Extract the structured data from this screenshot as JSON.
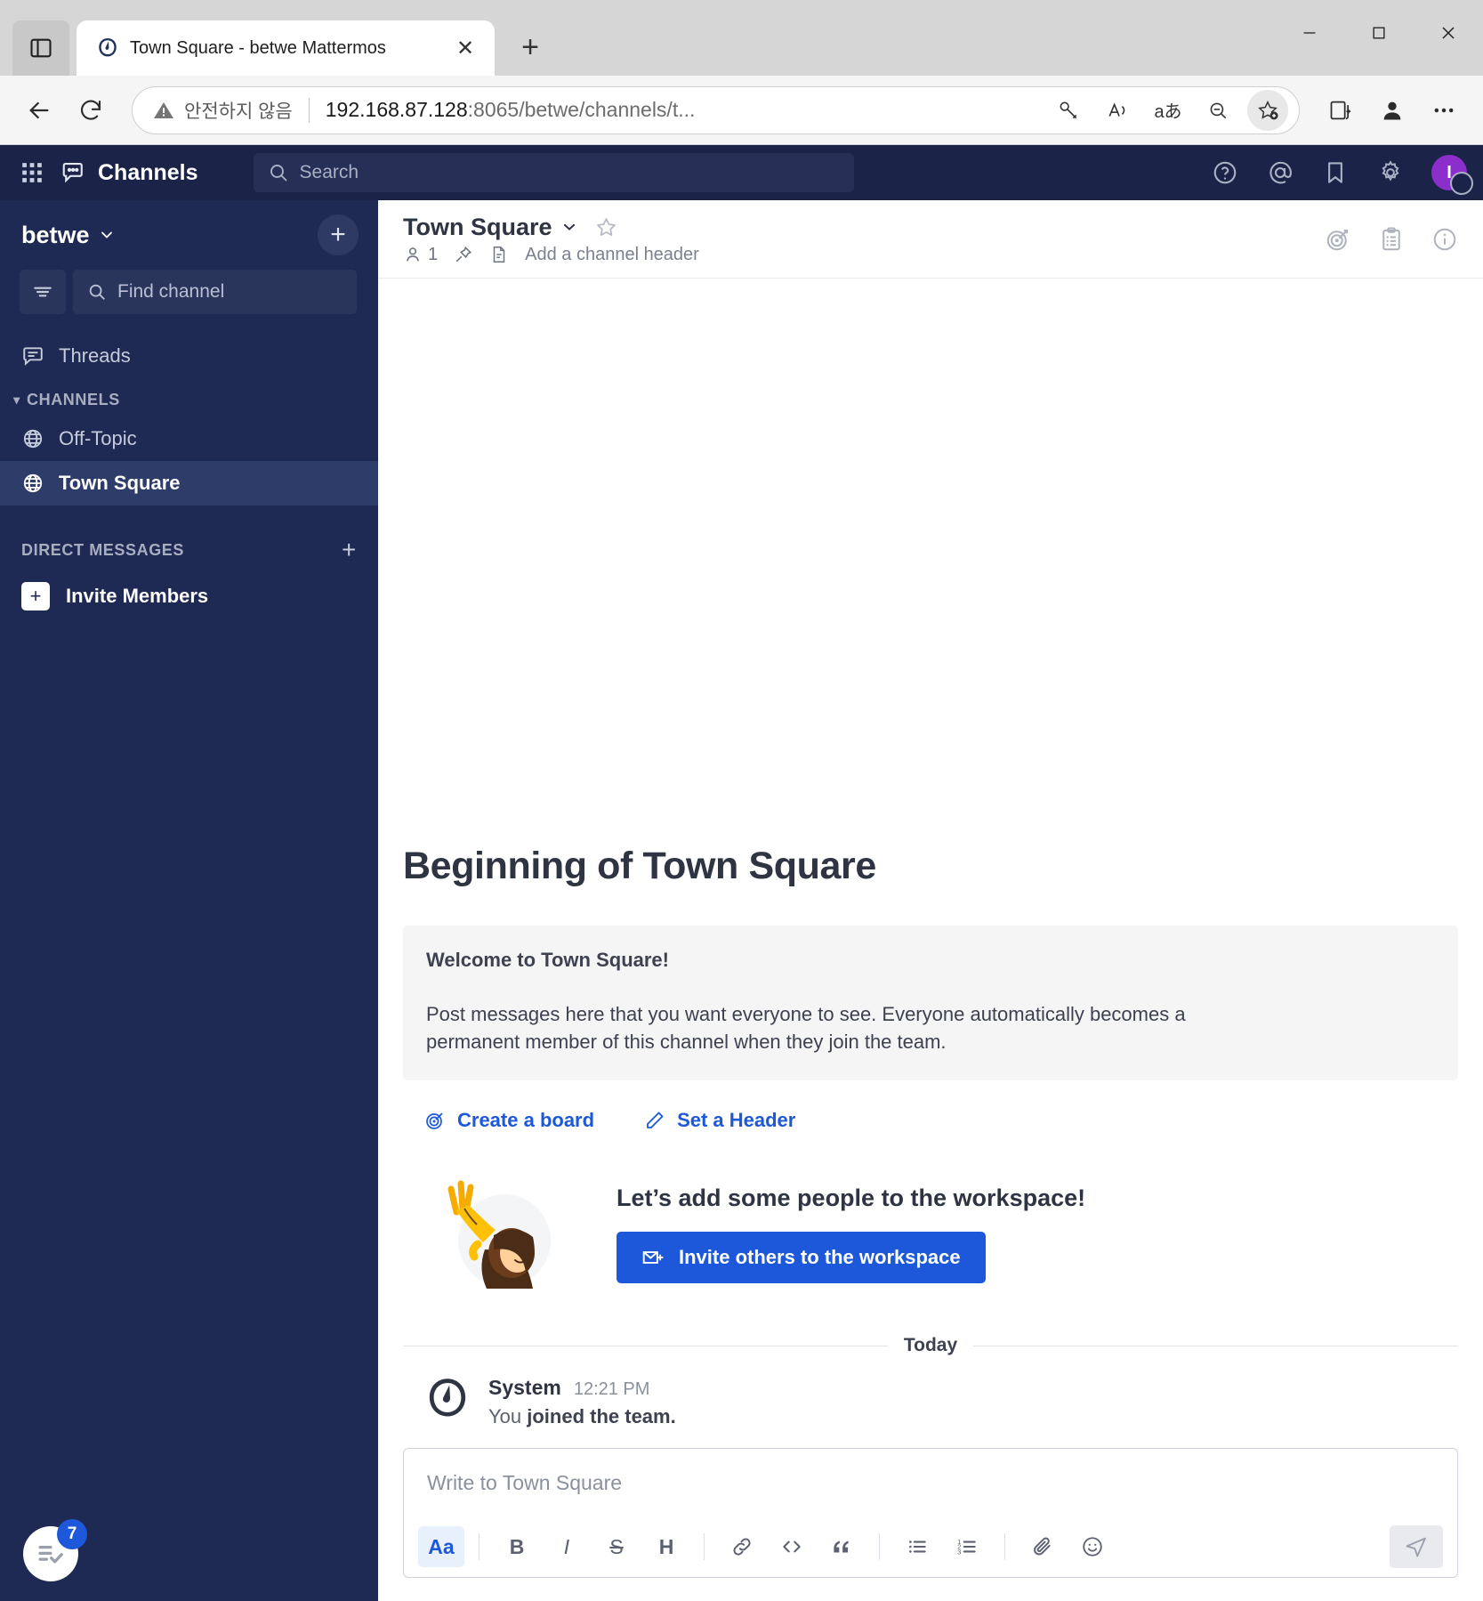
{
  "browser": {
    "tab": {
      "title": "Town Square - betwe Mattermos",
      "favicon_name": "mattermost-favicon",
      "close_label": "✕"
    },
    "new_tab_label": "+",
    "window_controls": {
      "minimize": "─",
      "maximize": "☐",
      "close": "✕"
    },
    "omnibox": {
      "security_label": "안전하지 않음",
      "url_host": "192.168.87.128",
      "url_rest": ":8065/betwe/channels/t...",
      "read_aloud_label": "A",
      "translate_label": "あ"
    }
  },
  "global_header": {
    "product_name": "Channels",
    "search_placeholder": "Search",
    "icons": [
      "help-icon",
      "mentions-icon",
      "saved-posts-icon",
      "settings-icon"
    ],
    "avatar_initial": "I",
    "accent_avatar_color": "#8b2ecc"
  },
  "sidebar": {
    "team_name": "betwe",
    "add_label": "+",
    "find_channel_placeholder": "Find channel",
    "threads_label": "Threads",
    "categories": [
      {
        "label": "CHANNELS",
        "add_label": "",
        "items": [
          {
            "label": "Off-Topic",
            "icon": "globe-icon",
            "active": false
          },
          {
            "label": "Town Square",
            "icon": "globe-icon",
            "active": true
          }
        ]
      },
      {
        "label": "DIRECT MESSAGES",
        "add_label": "+",
        "items": []
      }
    ],
    "invite_members_label": "Invite Members",
    "checklist_badge": "7"
  },
  "channel_header": {
    "title": "Town Square",
    "member_count": "1",
    "add_header_label": "Add a channel header",
    "right_icons": [
      "playbooks-icon",
      "boards-icon",
      "channel-info-icon"
    ]
  },
  "intro": {
    "title": "Beginning of Town Square",
    "welcome": "Welcome to Town Square!",
    "description": "Post messages here that you want everyone to see. Everyone automatically becomes a permanent member of this channel when they join the team.",
    "actions": [
      {
        "label": "Create a board",
        "icon": "board-target-icon"
      },
      {
        "label": "Set a Header",
        "icon": "pencil-icon"
      }
    ],
    "invite": {
      "title": "Let’s add some people to the workspace!",
      "button_label": "Invite others to the workspace",
      "button_color": "#1c58d9"
    }
  },
  "posts": {
    "date_separator": "Today",
    "items": [
      {
        "author": "System",
        "time": "12:21 PM",
        "text_prefix": "You ",
        "text_bold": "joined the team."
      }
    ]
  },
  "composer": {
    "placeholder": "Write to Town Square",
    "toolbar": [
      {
        "name": "formatting-toggle",
        "label": "Aa"
      },
      {
        "name": "bold-button",
        "label": "B"
      },
      {
        "name": "italic-button",
        "label": "I"
      },
      {
        "name": "strikethrough-button",
        "label": "S"
      },
      {
        "name": "heading-button",
        "label": "H"
      },
      {
        "name": "link-button",
        "label": "🔗"
      },
      {
        "name": "code-button",
        "label": "<>"
      },
      {
        "name": "quote-button",
        "label": "“"
      },
      {
        "name": "bulleted-list-button",
        "label": "☰"
      },
      {
        "name": "ordered-list-button",
        "label": "≡"
      },
      {
        "name": "attachment-button",
        "label": "📎"
      },
      {
        "name": "emoji-button",
        "label": "☺"
      }
    ],
    "send_label": "➤"
  }
}
